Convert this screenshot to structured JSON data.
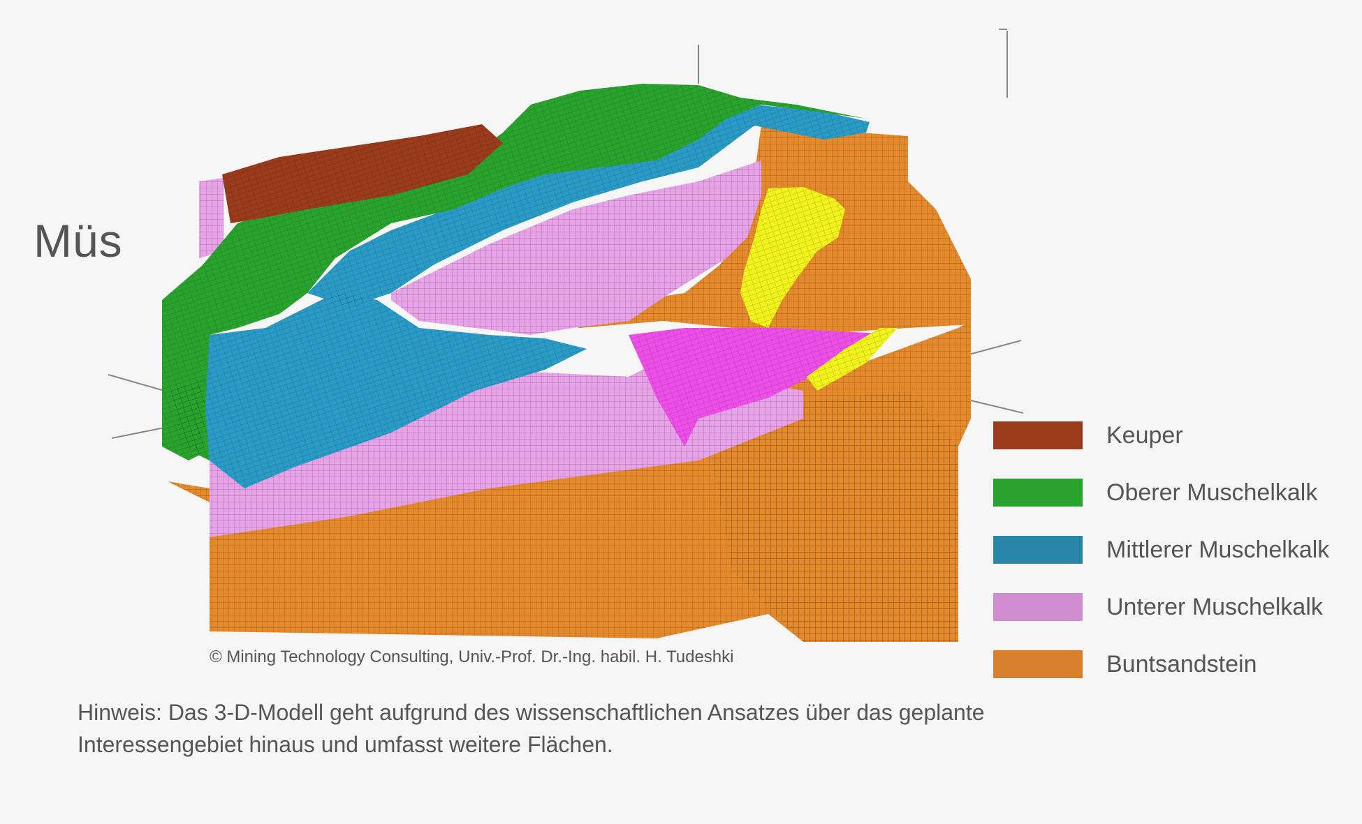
{
  "heading": "Müs",
  "copyright": "© Mining Technology Consulting, Univ.-Prof. Dr.-Ing. habil. H. Tudeshki",
  "note": {
    "line1": "Hinweis: Das 3-D-Modell geht aufgrund des wissenschaftlichen Ansatzes über das geplante",
    "line2": "Interessengebiet hinaus und umfasst weitere Flächen."
  },
  "legend": [
    {
      "label": "Keuper",
      "color": "#9a3b1b"
    },
    {
      "label": "Oberer Muschelkalk",
      "color": "#2aa32e"
    },
    {
      "label": "Mittlerer Muschelkalk",
      "color": "#2a86a8"
    },
    {
      "label": "Unterer Muschelkalk",
      "color": "#d08ed0"
    },
    {
      "label": "Buntsandstein",
      "color": "#d8802e"
    }
  ],
  "model_colors": {
    "keuper": "#9a3b1b",
    "oberer": "#2aa32e",
    "mittlerer": "#2a9bc6",
    "unterer": "#e8a2e8",
    "buntsandstein": "#e58a2c",
    "magenta_zone": "#ee4ee8",
    "yellow_zone": "#f2f21c",
    "axis": "#888888"
  }
}
